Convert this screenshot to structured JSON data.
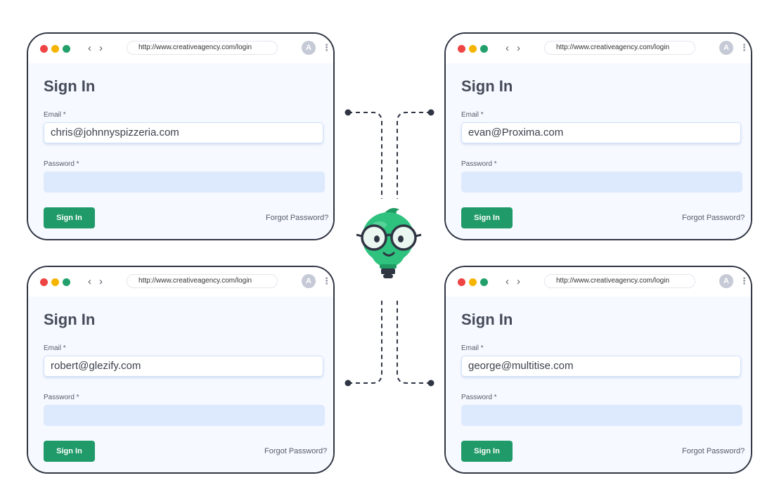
{
  "windows": [
    {
      "url": "http://www.creativeagency.com/login",
      "avatar_letter": "A",
      "title": "Sign In",
      "email_label": "Email *",
      "email_value": "chris@johnnyspizzeria.com",
      "password_label": "Password *",
      "signin_label": "Sign In",
      "forgot_label": "Forgot Password?"
    },
    {
      "url": "http://www.creativeagency.com/login",
      "avatar_letter": "A",
      "title": "Sign In",
      "email_label": "Email *",
      "email_value": "evan@Proxima.com",
      "password_label": "Password *",
      "signin_label": "Sign In",
      "forgot_label": "Forgot Password?"
    },
    {
      "url": "http://www.creativeagency.com/login",
      "avatar_letter": "A",
      "title": "Sign In",
      "email_label": "Email *",
      "email_value": "robert@glezify.com",
      "password_label": "Password *",
      "signin_label": "Sign In",
      "forgot_label": "Forgot Password?"
    },
    {
      "url": "http://www.creativeagency.com/login",
      "avatar_letter": "A",
      "title": "Sign In",
      "email_label": "Email *",
      "email_value": "george@multitise.com",
      "password_label": "Password *",
      "signin_label": "Sign In",
      "forgot_label": "Forgot Password?"
    }
  ],
  "nav_icons": {
    "back": "chevron-left-icon",
    "forward": "chevron-right-icon",
    "menu": "kebab-menu-icon"
  },
  "colors": {
    "accent_green": "#209a68",
    "traffic_red": "#ef4444",
    "traffic_yellow": "#f5b400",
    "traffic_green": "#22a06b",
    "mascot_green": "#2ec27e",
    "frame": "#2f3542"
  }
}
